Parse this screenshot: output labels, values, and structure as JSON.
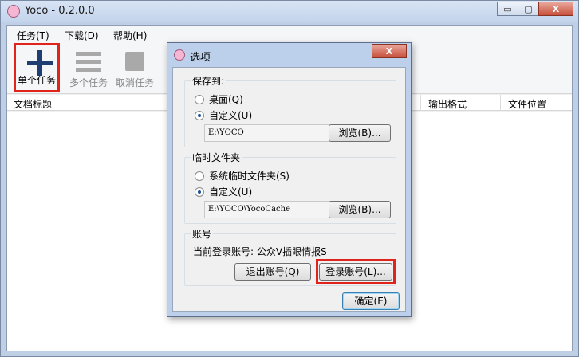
{
  "window": {
    "title": "Yoco - 0.2.0.0",
    "controls": {
      "minimize": "▭",
      "maximize": "▢",
      "close": "X"
    }
  },
  "menu": {
    "items": [
      "任务(T)",
      "下载(D)",
      "帮助(H)"
    ]
  },
  "toolbar": {
    "single_task": "单个任务",
    "multi_task": "多个任务",
    "cancel_task": "取消任务"
  },
  "list": {
    "columns": [
      "文档标题",
      "输出格式",
      "文件位置"
    ]
  },
  "dialog": {
    "title": "选项",
    "close": "X",
    "save_to": {
      "title": "保存到:",
      "option_desktop": "桌面(Q)",
      "option_custom": "自定义(U)",
      "path": "E:\\YOCO",
      "browse": "浏览(B)..."
    },
    "temp_folder": {
      "title": "临时文件夹",
      "option_system": "系统临时文件夹(S)",
      "option_custom": "自定义(U)",
      "path": "E:\\YOCO\\YocoCache",
      "browse": "浏览(B)..."
    },
    "account": {
      "title": "账号",
      "current_label": "当前登录账号: 公众V插眼情报S",
      "logout": "退出账号(Q)",
      "login": "登录账号(L)..."
    },
    "ok": "确定(E)"
  },
  "colors": {
    "highlight": "#e0241b",
    "accent": "#1b4f95"
  }
}
